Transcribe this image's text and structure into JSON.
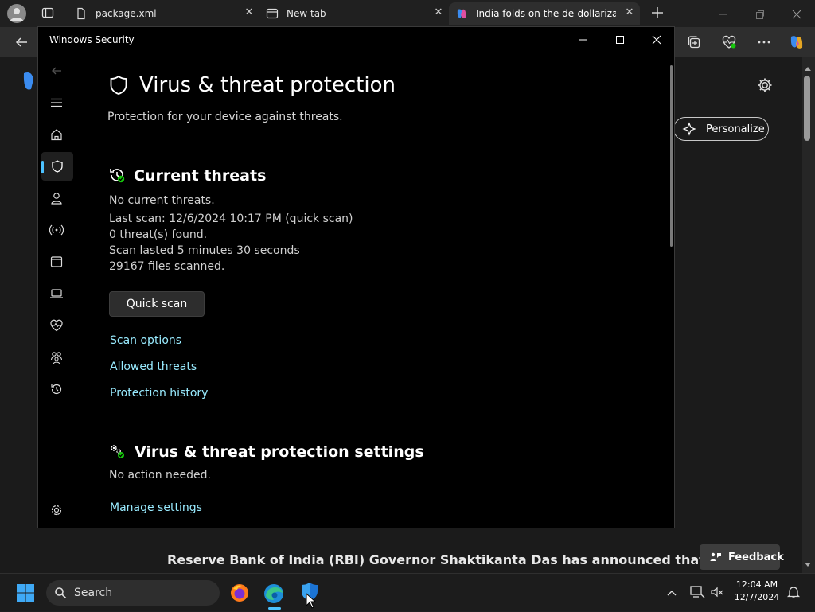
{
  "browser": {
    "tabs": [
      {
        "label": "package.xml",
        "icon": "document-icon"
      },
      {
        "label": "New tab",
        "icon": "new-tab-icon"
      },
      {
        "label": "India folds on the de-dollarization",
        "icon": "copilot-icon"
      }
    ],
    "personalize_label": "Personalize",
    "feedback_label": "Feedback",
    "article_text": "Reserve Bank of India (RBI) Governor Shaktikanta Das has announced that"
  },
  "windows_security": {
    "window_title": "Windows Security",
    "page_title": "Virus & threat protection",
    "page_subtitle": "Protection for your device against threats.",
    "current_threats": {
      "heading": "Current threats",
      "status": "No current threats.",
      "last_scan": "Last scan: 12/6/2024 10:17 PM (quick scan)",
      "threats_found": "0 threat(s) found.",
      "scan_duration": "Scan lasted 5 minutes 30 seconds",
      "files_scanned": "29167 files scanned.",
      "quick_scan_label": "Quick scan",
      "links": [
        "Scan options",
        "Allowed threats",
        "Protection history"
      ]
    },
    "settings": {
      "heading": "Virus & threat protection settings",
      "status": "No action needed.",
      "link": "Manage settings"
    },
    "nav_icons": [
      "back-icon",
      "menu-icon",
      "home-icon",
      "shield-icon",
      "account-icon",
      "wifi-icon",
      "app-browser-icon",
      "laptop-icon",
      "health-icon",
      "family-icon",
      "history-icon",
      "settings-icon"
    ]
  },
  "taskbar": {
    "search_placeholder": "Search",
    "time": "12:04 AM",
    "date": "12/7/2024"
  },
  "colors": {
    "accent": "#4cc2ff",
    "link": "#99ebff",
    "status_ok": "#16c60c"
  }
}
